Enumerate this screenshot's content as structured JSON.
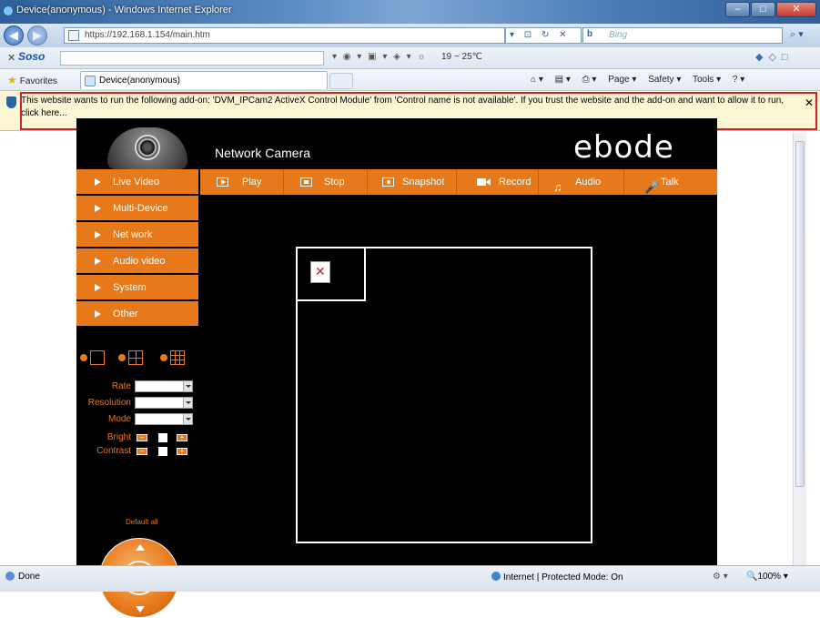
{
  "browser": {
    "title": "Device(anonymous) - Windows Internet Explorer",
    "url": "https://192.168.1.154/main.htm",
    "search_engine": "Bing",
    "tab_title": "Device(anonymous)",
    "favorites": "Favorites",
    "toolbar_brand": "Soso",
    "weather": "19 ~ 25℃",
    "command_bar": [
      "Page ▾",
      "Safety ▾",
      "Tools ▾"
    ]
  },
  "infobar": {
    "message": "This website wants to run the following add-on: 'DVM_IPCam2 ActiveX Control Module' from 'Control name is not available'. If you trust the website and the add-on and want to allow it to run, click here..."
  },
  "camera": {
    "header_title": "Network Camera",
    "brand": "ebode",
    "menu": [
      "Live Video",
      "Multi-Device",
      "Net work",
      "Audio video",
      "System",
      "Other"
    ],
    "toolbar": [
      "Play",
      "Stop",
      "Snapshot",
      "Record",
      "Audio",
      "Talk"
    ],
    "controls": {
      "rate": "Rate",
      "resolution": "Resolution",
      "mode": "Mode",
      "bright": "Bright",
      "contrast": "Contrast",
      "default_all": "Default all"
    },
    "accent_color": "#e8791a"
  },
  "statusbar": {
    "done": "Done",
    "zone": "Internet | Protected Mode: On",
    "zoom": "100%"
  }
}
